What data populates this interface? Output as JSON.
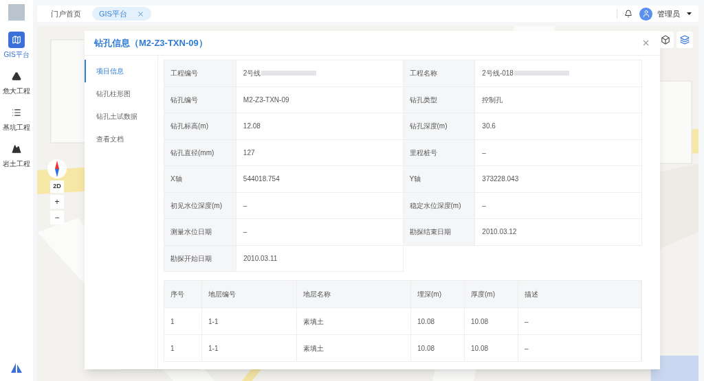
{
  "sidebar": {
    "items": [
      {
        "label": "GIS平台",
        "kind": "map",
        "selected": true
      },
      {
        "label": "危大工程",
        "kind": "warning",
        "selected": false
      },
      {
        "label": "基坑工程",
        "kind": "list",
        "selected": false
      },
      {
        "label": "岩土工程",
        "kind": "mountain",
        "selected": false
      }
    ]
  },
  "tabs": [
    {
      "label": "门户首页",
      "selected": false,
      "closable": false
    },
    {
      "label": "GIS平台",
      "selected": true,
      "closable": true
    }
  ],
  "user": {
    "name": "管理员"
  },
  "map_controls": {
    "view_mode": "2D",
    "zoom_in": "+",
    "zoom_out": "−"
  },
  "dialog": {
    "title": "钻孔信息（M2-Z3-TXN-09）",
    "nav": [
      {
        "label": "项目信息",
        "selected": true
      },
      {
        "label": "钻孔柱形图",
        "selected": false
      },
      {
        "label": "钻孔土试数据",
        "selected": false
      },
      {
        "label": "查看文档",
        "selected": false
      }
    ],
    "fields": [
      {
        "label": "工程编号",
        "value": "2号线",
        "redacted": true
      },
      {
        "label": "工程名称",
        "value": "2号线-018",
        "redacted": true
      },
      {
        "label": "钻孔编号",
        "value": "M2-Z3-TXN-09",
        "redacted": false
      },
      {
        "label": "钻孔类型",
        "value": "控制孔",
        "redacted": false
      },
      {
        "label": "钻孔标高(m)",
        "value": "12.08",
        "redacted": false
      },
      {
        "label": "钻孔深度(m)",
        "value": "30.6",
        "redacted": false
      },
      {
        "label": "钻孔直径(mm)",
        "value": "127",
        "redacted": false
      },
      {
        "label": "里程桩号",
        "value": "–",
        "redacted": false
      },
      {
        "label": "X轴",
        "value": "544018.754",
        "redacted": false
      },
      {
        "label": "Y轴",
        "value": "373228.043",
        "redacted": false
      },
      {
        "label": "初见水位深度(m)",
        "value": "–",
        "redacted": false
      },
      {
        "label": "稳定水位深度(m)",
        "value": "–",
        "redacted": false
      },
      {
        "label": "测量水位日期",
        "value": "–",
        "redacted": false
      },
      {
        "label": "勘探结束日期",
        "value": "2010.03.12",
        "redacted": false
      },
      {
        "label": "勘探开始日期",
        "value": "2010.03.11",
        "redacted": false
      }
    ],
    "table": {
      "columns": [
        "序号",
        "地层编号",
        "地层名称",
        "埋深(m)",
        "厚度(m)",
        "描述"
      ],
      "rows": [
        [
          "1",
          "1-1",
          "素填土",
          "10.08",
          "10.08",
          "–"
        ],
        [
          "1",
          "1-1",
          "素填土",
          "10.08",
          "10.08",
          "–"
        ]
      ]
    }
  }
}
